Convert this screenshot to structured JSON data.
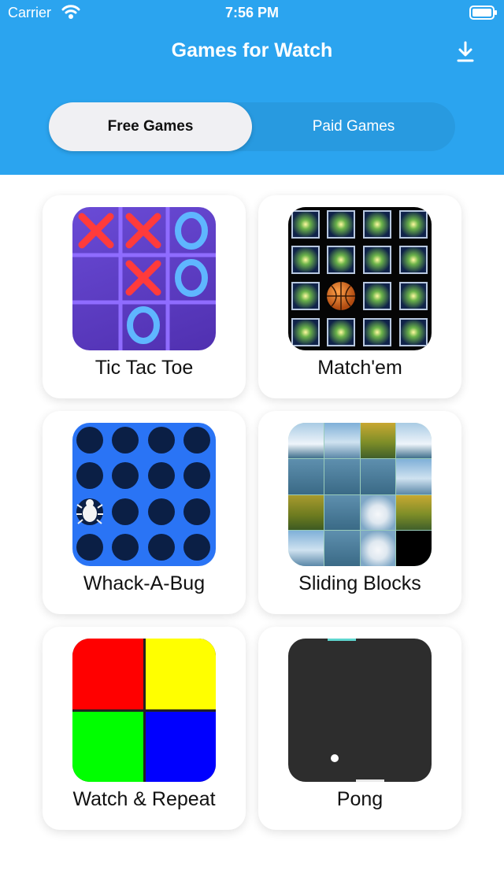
{
  "status_bar": {
    "carrier": "Carrier",
    "time": "7:56 PM"
  },
  "header": {
    "title": "Games for Watch",
    "download_icon": "download-icon",
    "background": "#2ba4ef"
  },
  "segments": {
    "free": "Free Games",
    "paid": "Paid Games",
    "selected": "Free Games"
  },
  "games": [
    {
      "name": "Tic Tac Toe"
    },
    {
      "name": "Match'em"
    },
    {
      "name": "Whack-A-Bug"
    },
    {
      "name": "Sliding Blocks"
    },
    {
      "name": "Watch & Repeat"
    },
    {
      "name": "Pong"
    }
  ],
  "colors": {
    "repeat": [
      "#ff0000",
      "#ffff00",
      "#00ff00",
      "#0000ff"
    ]
  }
}
